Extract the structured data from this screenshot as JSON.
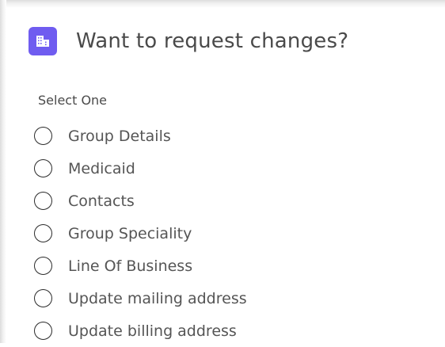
{
  "header": {
    "title": "Want to request changes?",
    "icon": "building-icon",
    "icon_color": "#6f5cf0"
  },
  "form": {
    "select_label": "Select One",
    "options": [
      {
        "label": "Group Details",
        "selected": false
      },
      {
        "label": "Medicaid",
        "selected": false
      },
      {
        "label": "Contacts",
        "selected": false
      },
      {
        "label": "Group Speciality",
        "selected": false
      },
      {
        "label": "Line Of Business",
        "selected": false
      },
      {
        "label": "Update mailing address",
        "selected": false
      },
      {
        "label": "Update billing address",
        "selected": false
      }
    ]
  }
}
